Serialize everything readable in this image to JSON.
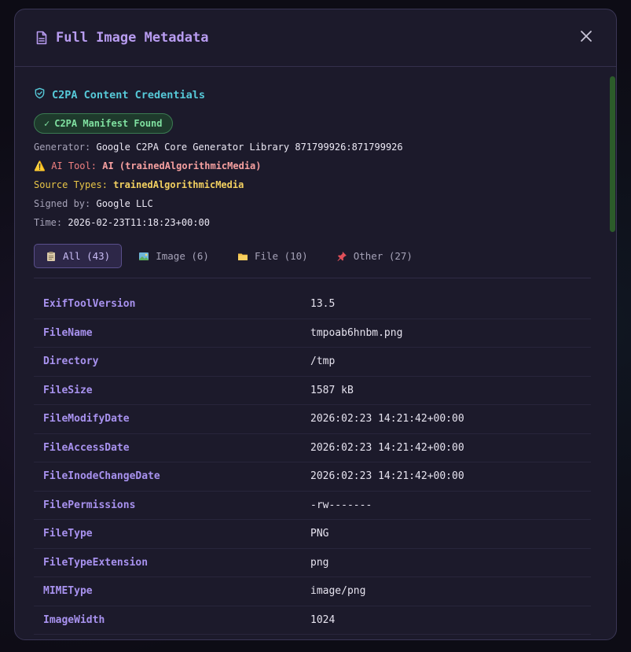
{
  "modal": {
    "title": "Full Image Metadata",
    "close_icon": "close-icon",
    "title_icon": "document-icon"
  },
  "c2pa": {
    "section_title": "C2PA Content Credentials",
    "badge": "C2PA Manifest Found",
    "generator_label": "Generator:",
    "generator": "Google C2PA Core Generator Library 871799926:871799926",
    "ai_tool_label": "AI Tool:",
    "ai_tool": "AI (trainedAlgorithmicMedia)",
    "source_types_label": "Source Types:",
    "source_types": "trainedAlgorithmicMedia",
    "signed_by_label": "Signed by:",
    "signed_by": "Google LLC",
    "time_label": "Time:",
    "time": "2026-02-23T11:18:23+00:00"
  },
  "tabs": [
    {
      "label": "All (43)",
      "icon": "clipboard-icon",
      "active": true
    },
    {
      "label": "Image (6)",
      "icon": "picture-icon",
      "active": false
    },
    {
      "label": "File (10)",
      "icon": "folder-icon",
      "active": false
    },
    {
      "label": "Other (27)",
      "icon": "pushpin-icon",
      "active": false
    }
  ],
  "rows": [
    {
      "key": "ExifToolVersion",
      "value": "13.5"
    },
    {
      "key": "FileName",
      "value": "tmpoab6hnbm.png"
    },
    {
      "key": "Directory",
      "value": "/tmp"
    },
    {
      "key": "FileSize",
      "value": "1587 kB"
    },
    {
      "key": "FileModifyDate",
      "value": "2026:02:23 14:21:42+00:00"
    },
    {
      "key": "FileAccessDate",
      "value": "2026:02:23 14:21:42+00:00"
    },
    {
      "key": "FileInodeChangeDate",
      "value": "2026:02:23 14:21:42+00:00"
    },
    {
      "key": "FilePermissions",
      "value": "-rw-------"
    },
    {
      "key": "FileType",
      "value": "PNG"
    },
    {
      "key": "FileTypeExtension",
      "value": "png"
    },
    {
      "key": "MIMEType",
      "value": "image/png"
    },
    {
      "key": "ImageWidth",
      "value": "1024"
    }
  ],
  "colors": {
    "accent": "#b89cf0",
    "c2pa_title": "#56c9d8",
    "badge_text": "#7fe0a0",
    "ai_warning": "#f08080",
    "source_types": "#e8c547"
  }
}
